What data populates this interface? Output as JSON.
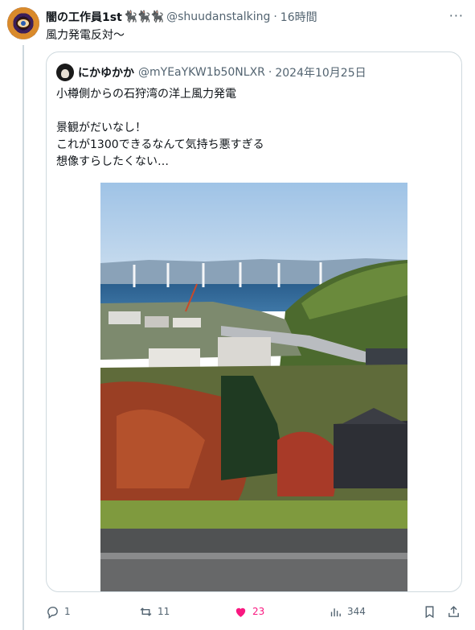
{
  "tweet": {
    "author_name": "闇の工作員1st",
    "author_emoji": "🐈‍⬛🐈‍⬛🐈‍⬛",
    "handle": "@shuudanstalking",
    "separator": "·",
    "time": "16時間",
    "more": "···",
    "text": "風力発電反対〜"
  },
  "quoted": {
    "author_name": "にかゆかか",
    "handle": "@mYEaYKW1b50NLXR",
    "separator": "·",
    "date": "2024年10月25日",
    "lines": [
      "小樽側からの石狩湾の洋上風力発電",
      "",
      "景観がだいなし！",
      "これが1300できるなんて気持ち悪すぎる",
      "想像すらしたくない…"
    ]
  },
  "actions": {
    "reply_count": "1",
    "retweet_count": "11",
    "like_count": "23",
    "view_count": "344"
  },
  "colors": {
    "like_accent": "#f91880",
    "muted_text": "#536471",
    "border": "#cfd9de"
  },
  "icons": [
    "reply-icon",
    "retweet-icon",
    "heart-icon",
    "views-icon",
    "bookmark-icon",
    "share-icon",
    "more-icon"
  ]
}
